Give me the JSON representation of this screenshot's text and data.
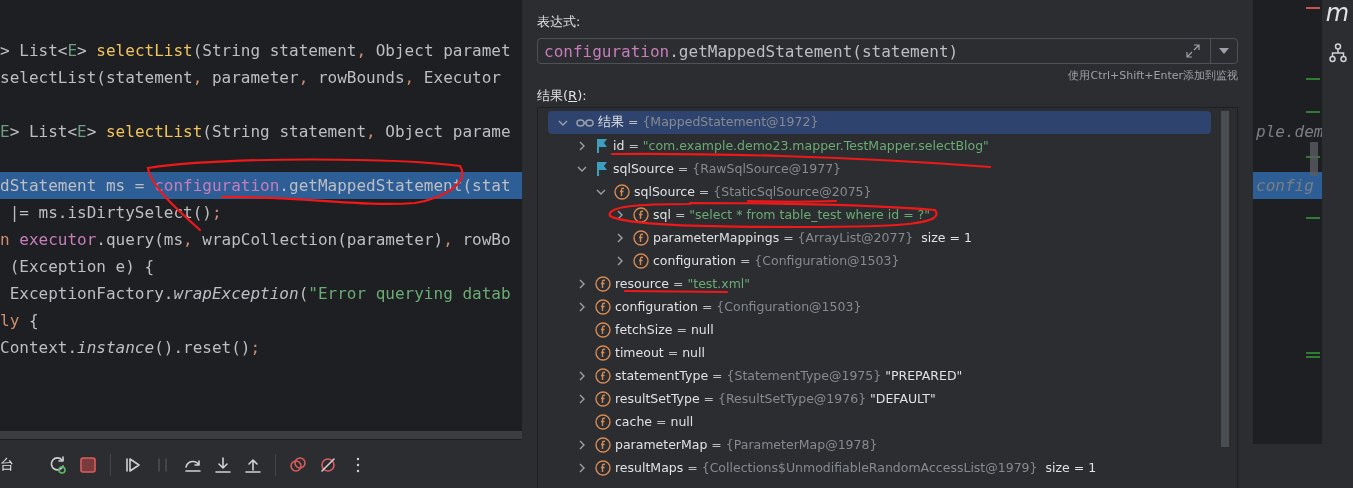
{
  "editor": {
    "lines": [
      {
        "current": false,
        "tokens": [
          {
            "text": "> List<",
            "kind": "plain"
          },
          {
            "text": "E",
            "kind": "typeparam"
          },
          {
            "text": "> ",
            "kind": "plain"
          },
          {
            "text": "selectList",
            "kind": "method"
          },
          {
            "text": "(String statement",
            "kind": "plain"
          },
          {
            "text": ",",
            "kind": "keyword"
          },
          {
            "text": " Object paramet",
            "kind": "plain"
          }
        ]
      },
      {
        "current": false,
        "tokens": [
          {
            "text": "selectList(statement",
            "kind": "plain"
          },
          {
            "text": ",",
            "kind": "keyword"
          },
          {
            "text": " parameter",
            "kind": "plain"
          },
          {
            "text": ",",
            "kind": "keyword"
          },
          {
            "text": " rowBounds",
            "kind": "plain"
          },
          {
            "text": ",",
            "kind": "keyword"
          },
          {
            "text": " Executor",
            "kind": "plain"
          }
        ]
      },
      {
        "current": false
      },
      {
        "current": false,
        "tokens": [
          {
            "text": "E",
            "kind": "typeparam"
          },
          {
            "text": "> List<",
            "kind": "plain"
          },
          {
            "text": "E",
            "kind": "typeparam"
          },
          {
            "text": "> ",
            "kind": "plain"
          },
          {
            "text": "selectList",
            "kind": "method"
          },
          {
            "text": "(String statement",
            "kind": "plain"
          },
          {
            "text": ",",
            "kind": "keyword"
          },
          {
            "text": " Object parame",
            "kind": "plain"
          }
        ],
        "tail": "ple.dem"
      },
      {
        "current": false
      },
      {
        "current": true,
        "tokens": [
          {
            "text": "dStatement ms = ",
            "kind": "plain"
          },
          {
            "text": "configuration",
            "kind": "field"
          },
          {
            "text": ".getMappedStatement(stat",
            "kind": "plain"
          }
        ],
        "tail": "config"
      },
      {
        "current": false,
        "tokens": [
          {
            "text": " |= ms.isDirtySelect()",
            "kind": "plain"
          },
          {
            "text": ";",
            "kind": "keyword"
          }
        ]
      },
      {
        "current": false,
        "tokens": [
          {
            "text": "n",
            "kind": "keyword"
          },
          {
            "text": " executor",
            "kind": "field"
          },
          {
            "text": ".query(ms",
            "kind": "plain"
          },
          {
            "text": ",",
            "kind": "keyword"
          },
          {
            "text": " wrapCollection(parameter)",
            "kind": "plain"
          },
          {
            "text": ",",
            "kind": "keyword"
          },
          {
            "text": " rowBo",
            "kind": "plain"
          }
        ]
      },
      {
        "current": false,
        "tokens": [
          {
            "text": " (Exception e) {",
            "kind": "plain"
          }
        ]
      },
      {
        "current": false,
        "tokens": [
          {
            "text": " ExceptionFactory.",
            "kind": "plain"
          },
          {
            "text": "wrapException",
            "kind": "italic"
          },
          {
            "text": "(",
            "kind": "plain"
          },
          {
            "text": "\"Error querying datab",
            "kind": "string"
          }
        ]
      },
      {
        "current": false,
        "tokens": [
          {
            "text": "ly",
            "kind": "keyword"
          },
          {
            "text": " {",
            "kind": "plain"
          }
        ]
      },
      {
        "current": false,
        "tokens": [
          {
            "text": "Context.",
            "kind": "plain"
          },
          {
            "text": "instance",
            "kind": "italic"
          },
          {
            "text": "().reset()",
            "kind": "plain"
          },
          {
            "text": ";",
            "kind": "keyword"
          }
        ]
      }
    ]
  },
  "debug_toolbar": {
    "tab_label": "台",
    "button_groups": [
      [
        {
          "kind": "rerun",
          "disabled": false
        },
        {
          "kind": "stop",
          "disabled": false
        }
      ],
      [
        {
          "kind": "resume",
          "disabled": false
        },
        {
          "kind": "pause",
          "disabled": true
        },
        {
          "kind": "step-over",
          "disabled": false
        },
        {
          "kind": "step-into",
          "disabled": false
        },
        {
          "kind": "step-out",
          "disabled": false
        }
      ],
      [
        {
          "kind": "breakpoints",
          "disabled": false
        },
        {
          "kind": "mute",
          "disabled": false
        },
        {
          "kind": "more",
          "disabled": false
        }
      ]
    ]
  },
  "evaluate_dialog": {
    "expression_label": "表达式:",
    "expression": [
      {
        "text": "configuration",
        "kind": "field"
      },
      {
        "text": ".getMappedStatement(statement)",
        "kind": "plain"
      }
    ],
    "hint": "使用Ctrl+Shift+Enter添加到监视",
    "result_label": {
      "before": "结果(",
      "mnemonic": "R",
      "after": "):"
    },
    "tree": [
      {
        "kind": "watch",
        "name": "结果",
        "operator": "=",
        "ref": "{MappedStatement@1972}",
        "expandable": true,
        "expanded": true,
        "selected": true,
        "children": [
          {
            "kind": "flag",
            "name": "id",
            "operator": "=",
            "string": "\"com.example.demo23.mapper.TestMapper.selectBlog\"",
            "expandable": true,
            "expanded": false,
            "selected": false
          },
          {
            "kind": "flag",
            "name": "sqlSource",
            "operator": "=",
            "ref": "{RawSqlSource@1977}",
            "expandable": true,
            "expanded": true,
            "selected": false,
            "children": [
              {
                "kind": "field",
                "name": "sqlSource",
                "operator": "=",
                "ref": "{StaticSqlSource@2075}",
                "expandable": true,
                "expanded": true,
                "selected": false,
                "children": [
                  {
                    "kind": "field",
                    "name": "sql",
                    "operator": "=",
                    "string": "\"select * from table_test where id = ?\"",
                    "expandable": true,
                    "expanded": false,
                    "selected": false
                  },
                  {
                    "kind": "field",
                    "name": "parameterMappings",
                    "operator": "=",
                    "ref": "{ArrayList@2077}",
                    "extra": "size = 1",
                    "expandable": true,
                    "expanded": false,
                    "selected": false
                  },
                  {
                    "kind": "field",
                    "name": "configuration",
                    "operator": "=",
                    "ref": "{Configuration@1503}",
                    "expandable": true,
                    "expanded": false,
                    "selected": false
                  }
                ]
              }
            ]
          },
          {
            "kind": "field",
            "name": "resource",
            "operator": "=",
            "string": "\"test.xml\"",
            "expandable": true,
            "expanded": false,
            "selected": false
          },
          {
            "kind": "field",
            "name": "configuration",
            "operator": "=",
            "ref": "{Configuration@1503}",
            "expandable": true,
            "expanded": false,
            "selected": false
          },
          {
            "kind": "field",
            "name": "fetchSize",
            "operator": "=",
            "value": "null",
            "expandable": false,
            "selected": false
          },
          {
            "kind": "field",
            "name": "timeout",
            "operator": "=",
            "value": "null",
            "expandable": false,
            "selected": false
          },
          {
            "kind": "field",
            "name": "statementType",
            "operator": "=",
            "ref": "{StatementType@1975}",
            "value": "\"PREPARED\"",
            "expandable": true,
            "expanded": false,
            "selected": false
          },
          {
            "kind": "field",
            "name": "resultSetType",
            "operator": "=",
            "ref": "{ResultSetType@1976}",
            "value": "\"DEFAULT\"",
            "expandable": true,
            "expanded": false,
            "selected": false
          },
          {
            "kind": "field",
            "name": "cache",
            "operator": "=",
            "value": "null",
            "expandable": false,
            "selected": false
          },
          {
            "kind": "field",
            "name": "parameterMap",
            "operator": "=",
            "ref": "{ParameterMap@1978}",
            "expandable": true,
            "expanded": false,
            "selected": false
          },
          {
            "kind": "field",
            "name": "resultMaps",
            "operator": "=",
            "ref": "{Collections$UnmodifiableRandomAccessList@1979}",
            "extra": "size = 1",
            "expandable": true,
            "expanded": false,
            "selected": false
          }
        ]
      }
    ]
  },
  "tool_strip": {
    "letter": "m"
  }
}
